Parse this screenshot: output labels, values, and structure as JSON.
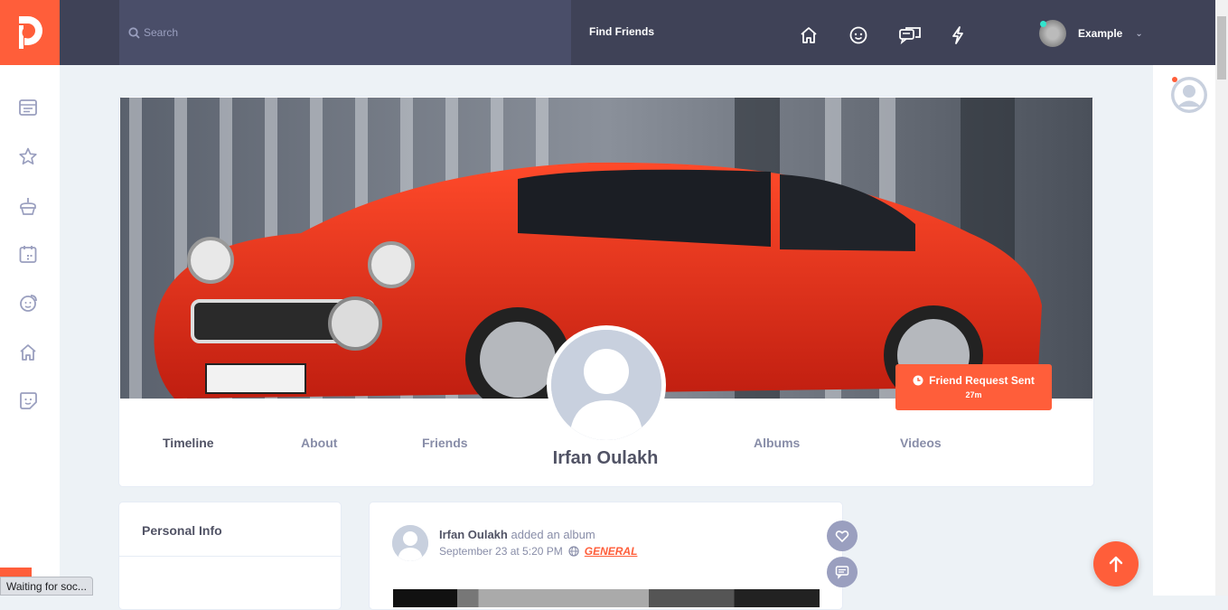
{
  "header": {
    "search_placeholder": "Search",
    "find_friends_label": "Find Friends",
    "user_name": "Example",
    "nav_icons": [
      "home-icon",
      "smiley-face-icon",
      "chat-messages-icon",
      "lightning-notifications-icon"
    ]
  },
  "sidebar": {
    "icons": [
      "newsfeed-icon",
      "star-icon",
      "cake-icon",
      "calendar-icon",
      "friends-group-icon",
      "home-icon",
      "sticker-icon"
    ]
  },
  "profile": {
    "name": "Irfan Oulakh",
    "friend_request_label": "Friend Request Sent",
    "friend_request_time": "27m",
    "tabs": [
      {
        "label": "Timeline",
        "active": true
      },
      {
        "label": "About",
        "active": false
      },
      {
        "label": "Friends",
        "active": false
      },
      {
        "label": "Albums",
        "active": false
      },
      {
        "label": "Videos",
        "active": false
      }
    ]
  },
  "personal_info": {
    "title": "Personal Info"
  },
  "post": {
    "author": "Irfan Oulakh",
    "action": "added an album",
    "timestamp": "September 23 at 5:20 PM",
    "privacy": "GENERAL"
  },
  "status_bar": {
    "text": "Waiting for soc..."
  },
  "colors": {
    "accent": "#ff5e3a",
    "topbar": "#3f4257",
    "search_bg": "#4a4e69",
    "page_bg": "#edf2f6",
    "muted_text": "#888da8",
    "dark_text": "#515365"
  }
}
